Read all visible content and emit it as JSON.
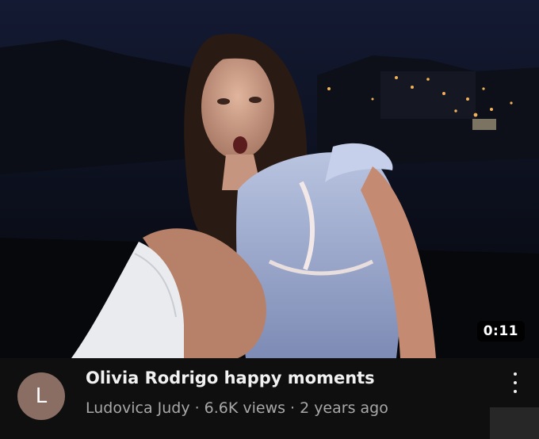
{
  "video": {
    "duration": "0:11",
    "title": "Olivia Rodrigo happy moments",
    "channel": "Ludovica Judy",
    "views": "6.6K views",
    "age": "2 years ago",
    "separator": "·"
  },
  "avatar": {
    "initial": "L",
    "color": "#8a6e64"
  },
  "menu_icon": "more-vert-icon",
  "colors": {
    "background": "#0f0f0f",
    "title": "#f1f1f1",
    "secondary_text": "#a8a8a8"
  }
}
